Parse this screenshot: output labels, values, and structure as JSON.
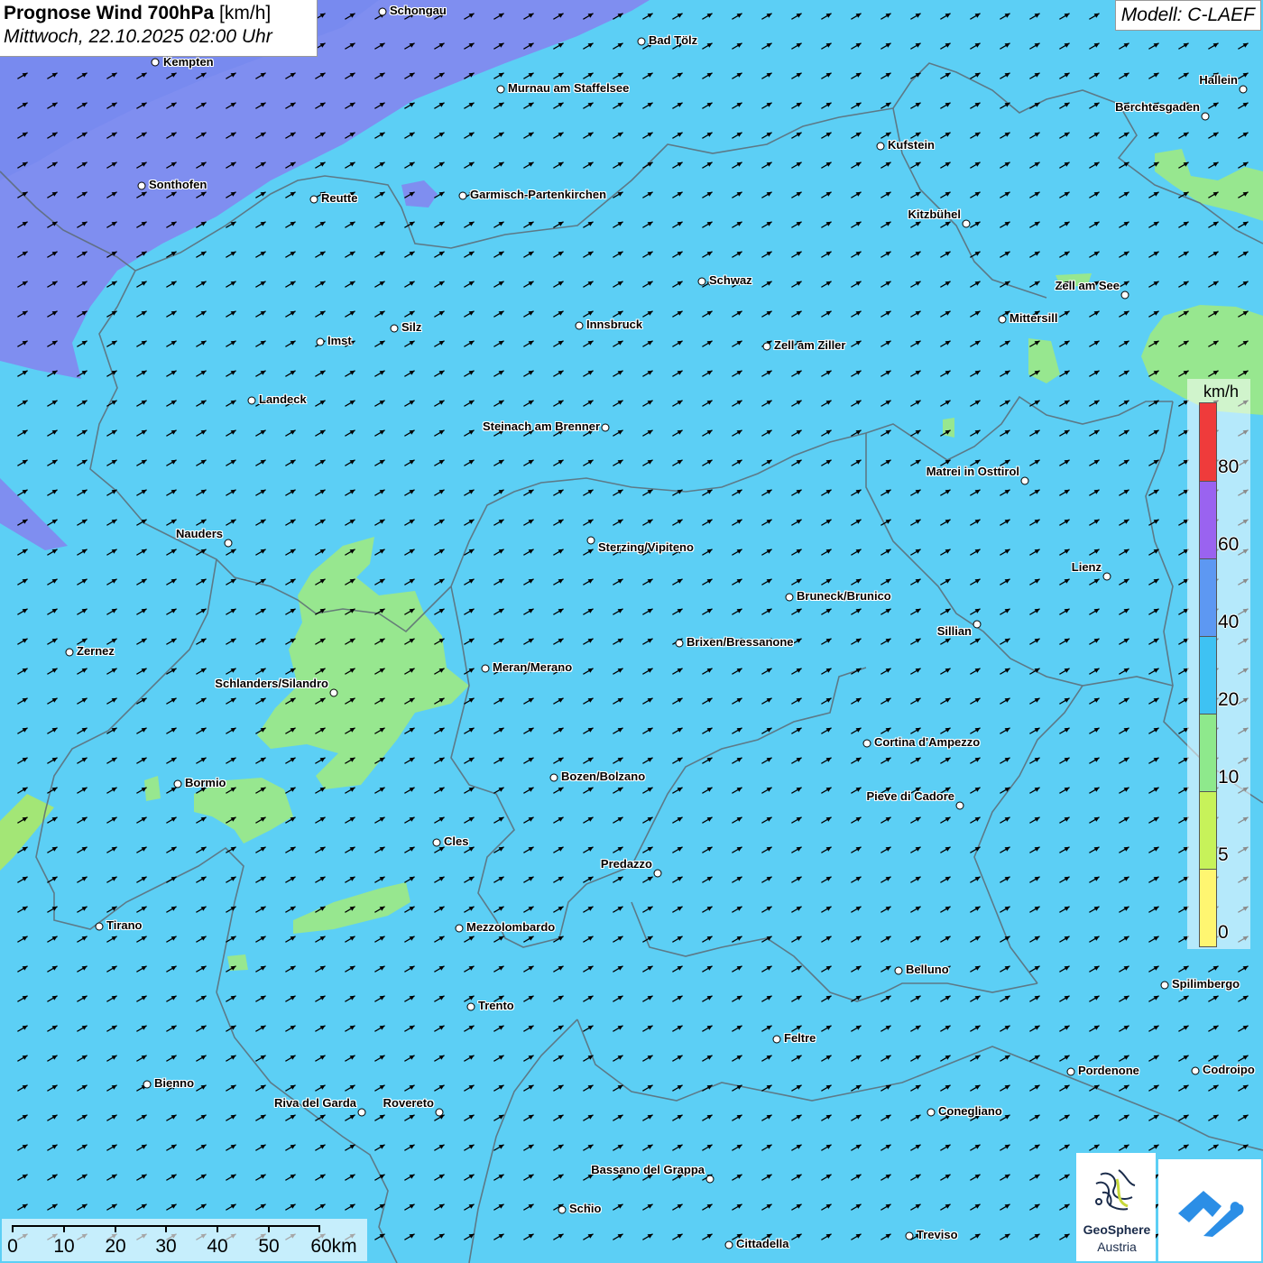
{
  "header": {
    "title_bold": "Prognose Wind 700hPa",
    "title_unit": "[km/h]",
    "datetime": "Mittwoch, 22.10.2025 02:00 Uhr",
    "model": "Modell: C-LAEF"
  },
  "colors": {
    "background": "#5ccff5",
    "zone_purple": "#7f8ef0",
    "zone_blue": "#6aa8f0",
    "zone_green": "#97e78f",
    "zone_green_dark": "#a3e676",
    "border": "#5d6b74",
    "arrow": "#000000"
  },
  "wind": {
    "direction_deg_from_east": -30,
    "arrow_spacing": 33
  },
  "legend": {
    "unit": "km/h",
    "labels": [
      "80",
      "60",
      "40",
      "20",
      "10",
      "5",
      "0"
    ],
    "segments": [
      {
        "color": "#ef3b3b"
      },
      {
        "color": "#e94848"
      },
      {
        "color": "#9a63f0"
      },
      {
        "color": "#5d98f2"
      },
      {
        "color": "#3ec2f3"
      },
      {
        "color": "#8ee98c"
      },
      {
        "color": "#c7f25a"
      },
      {
        "color": "#fff671"
      }
    ]
  },
  "scale_bar": {
    "labels": [
      "0",
      "10",
      "20",
      "30",
      "40",
      "50",
      "60km"
    ]
  },
  "logo": {
    "name_line1": "GeoSphere",
    "name_line2": "Austria"
  },
  "cities": [
    {
      "name": "Schongau"
    },
    {
      "name": "Bad Tölz"
    },
    {
      "name": "Kempten"
    },
    {
      "name": "Murnau am Staffelsee"
    },
    {
      "name": "Hallein"
    },
    {
      "name": "Berchtesgaden"
    },
    {
      "name": "Kufstein"
    },
    {
      "name": "Sonthofen"
    },
    {
      "name": "Reutte"
    },
    {
      "name": "Garmisch-Partenkirchen"
    },
    {
      "name": "Kitzbühel"
    },
    {
      "name": "Schwaz"
    },
    {
      "name": "Zell am See"
    },
    {
      "name": "Mittersill"
    },
    {
      "name": "Silz"
    },
    {
      "name": "Innsbruck"
    },
    {
      "name": "Imst"
    },
    {
      "name": "Zell am Ziller"
    },
    {
      "name": "Landeck"
    },
    {
      "name": "Steinach am Brenner"
    },
    {
      "name": "Matrei in Osttirol"
    },
    {
      "name": "Nauders"
    },
    {
      "name": "Sterzing/Vipiteno"
    },
    {
      "name": "Lienz"
    },
    {
      "name": "Bruneck/Brunico"
    },
    {
      "name": "Sillian"
    },
    {
      "name": "Zernez"
    },
    {
      "name": "Brixen/Bressanone"
    },
    {
      "name": "Meran/Merano"
    },
    {
      "name": "Schlanders/Silandro"
    },
    {
      "name": "Cortina d'Ampezzo"
    },
    {
      "name": "Bozen/Bolzano"
    },
    {
      "name": "Bormio"
    },
    {
      "name": "Pieve di Cadore"
    },
    {
      "name": "Cles"
    },
    {
      "name": "Predazzo"
    },
    {
      "name": "Tirano"
    },
    {
      "name": "Mezzolombardo"
    },
    {
      "name": "Belluno"
    },
    {
      "name": "Spilimbergo"
    },
    {
      "name": "Trento"
    },
    {
      "name": "Feltre"
    },
    {
      "name": "Pordenone"
    },
    {
      "name": "Codroipo"
    },
    {
      "name": "Bienno"
    },
    {
      "name": "Riva del Garda"
    },
    {
      "name": "Rovereto"
    },
    {
      "name": "Conegliano"
    },
    {
      "name": "Bassano del Grappa"
    },
    {
      "name": "Schio"
    },
    {
      "name": "Treviso"
    },
    {
      "name": "Cittadella"
    }
  ]
}
